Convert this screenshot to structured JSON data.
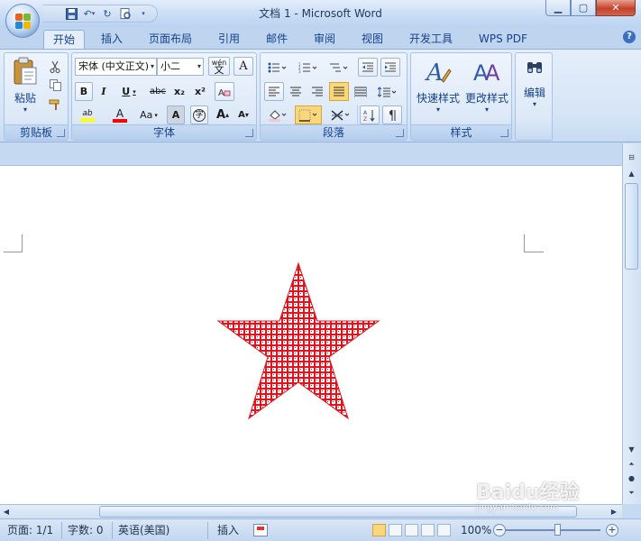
{
  "window": {
    "title": "文档 1 - Microsoft Word"
  },
  "tabs": [
    "开始",
    "插入",
    "页面布局",
    "引用",
    "邮件",
    "审阅",
    "视图",
    "开发工具",
    "WPS PDF"
  ],
  "ribbon": {
    "clipboard": {
      "label": "剪贴板",
      "paste": "粘贴"
    },
    "font": {
      "label": "字体",
      "font_name": "宋体 (中文正文)",
      "font_size": "小二",
      "bold": "B",
      "italic": "I",
      "underline": "U",
      "strike": "abc",
      "subscript": "x₂",
      "superscript": "x²",
      "font_color_glyph": "A",
      "change_case": "Aa",
      "grow": "A",
      "shrink": "A",
      "char_shading": "A",
      "enclose": "字",
      "phonetic": "wén"
    },
    "paragraph": {
      "label": "段落"
    },
    "styles": {
      "label": "样式",
      "quick_styles": "快速样式",
      "change_styles": "更改样式"
    },
    "editing": {
      "label": "编辑"
    }
  },
  "status": {
    "page": "页面: 1/1",
    "words": "字数: 0",
    "language": "英语(美国)",
    "insert_mode": "插入",
    "zoom": "100%"
  },
  "watermark": {
    "brand": "Baidu经验",
    "url": "jingyan.baidu.com"
  },
  "colors": {
    "star_red": "#e0141e",
    "highlight": "#ffff00",
    "font_color": "#ff0000"
  }
}
